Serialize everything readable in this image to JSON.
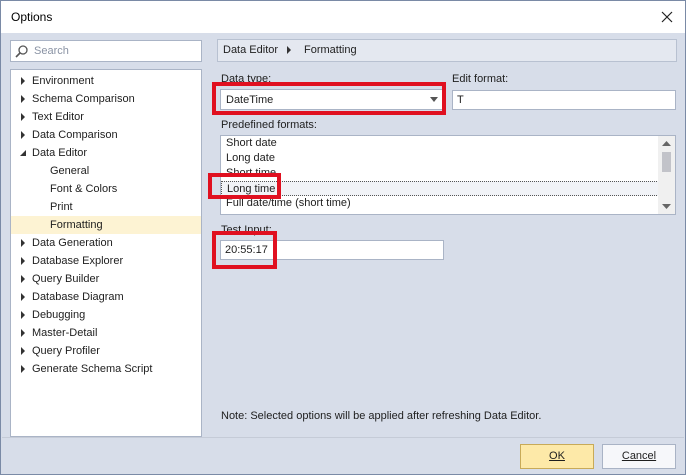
{
  "window": {
    "title": "Options"
  },
  "search": {
    "placeholder": "Search"
  },
  "tree": {
    "items": [
      {
        "label": "Environment",
        "expanded": false
      },
      {
        "label": "Schema Comparison",
        "expanded": false
      },
      {
        "label": "Text Editor",
        "expanded": false
      },
      {
        "label": "Data Comparison",
        "expanded": false
      },
      {
        "label": "Data Editor",
        "expanded": true
      },
      {
        "label": "General"
      },
      {
        "label": "Font & Colors"
      },
      {
        "label": "Print"
      },
      {
        "label": "Formatting",
        "selected": true
      },
      {
        "label": "Data Generation",
        "expanded": false
      },
      {
        "label": "Database Explorer",
        "expanded": false
      },
      {
        "label": "Query Builder",
        "expanded": false
      },
      {
        "label": "Database Diagram",
        "expanded": false
      },
      {
        "label": "Debugging",
        "expanded": false
      },
      {
        "label": "Master-Detail",
        "expanded": false
      },
      {
        "label": "Query Profiler",
        "expanded": false
      },
      {
        "label": "Generate Schema Script",
        "expanded": false
      }
    ]
  },
  "breadcrumb": {
    "parent": "Data Editor",
    "current": "Formatting"
  },
  "form": {
    "data_type_label": "Data type:",
    "data_type_value": "DateTime",
    "edit_format_label": "Edit format:",
    "edit_format_value": "T",
    "predefined_label": "Predefined formats:",
    "predefined_formats": [
      "Short date",
      "Long date",
      "Short time",
      "Long time",
      "Full date/time (short time)"
    ],
    "test_input_label": "Test Input:",
    "test_input_value": "20:55:17"
  },
  "note": "Note: Selected options will be applied after refreshing Data Editor.",
  "buttons": {
    "ok": "OK",
    "cancel": "Cancel"
  },
  "colors": {
    "highlight": "#e01020",
    "selected_tree": "#fdf3d3",
    "ok_button": "#fde9a8"
  }
}
